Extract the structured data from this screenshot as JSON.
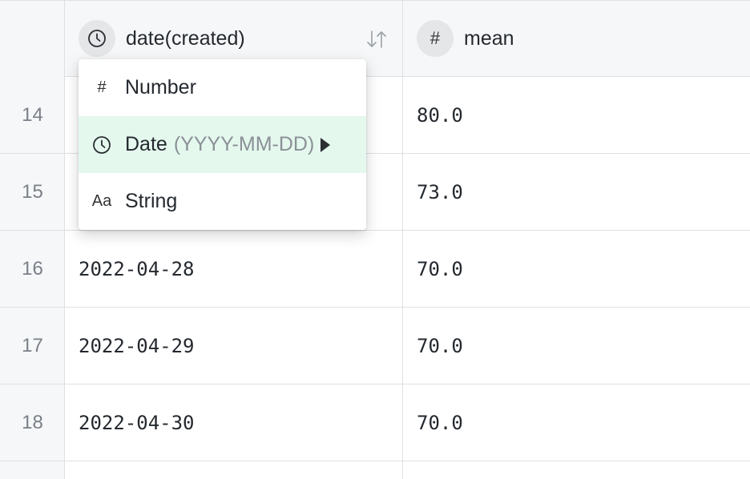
{
  "columns": [
    {
      "name": "date(created)",
      "type_icon": "clock-icon"
    },
    {
      "name": "mean",
      "type_icon": "#"
    }
  ],
  "rows": [
    {
      "index": "14",
      "date": "",
      "mean": "80.0"
    },
    {
      "index": "15",
      "date": "",
      "mean": "73.0"
    },
    {
      "index": "16",
      "date": "2022-04-28",
      "mean": "70.0"
    },
    {
      "index": "17",
      "date": "2022-04-29",
      "mean": "70.0"
    },
    {
      "index": "18",
      "date": "2022-04-30",
      "mean": "70.0"
    }
  ],
  "type_menu": {
    "items": [
      {
        "icon": "#",
        "label": "Number",
        "hint": ""
      },
      {
        "icon": "clock-icon",
        "label": "Date",
        "hint": "(YYYY-MM-DD)"
      },
      {
        "icon": "Aa",
        "label": "String",
        "hint": ""
      }
    ],
    "active_item": "Date"
  },
  "colors": {
    "active_item_bg": "#e4f8ee",
    "header_bg": "#f6f7f8",
    "border": "#dde0e3"
  }
}
